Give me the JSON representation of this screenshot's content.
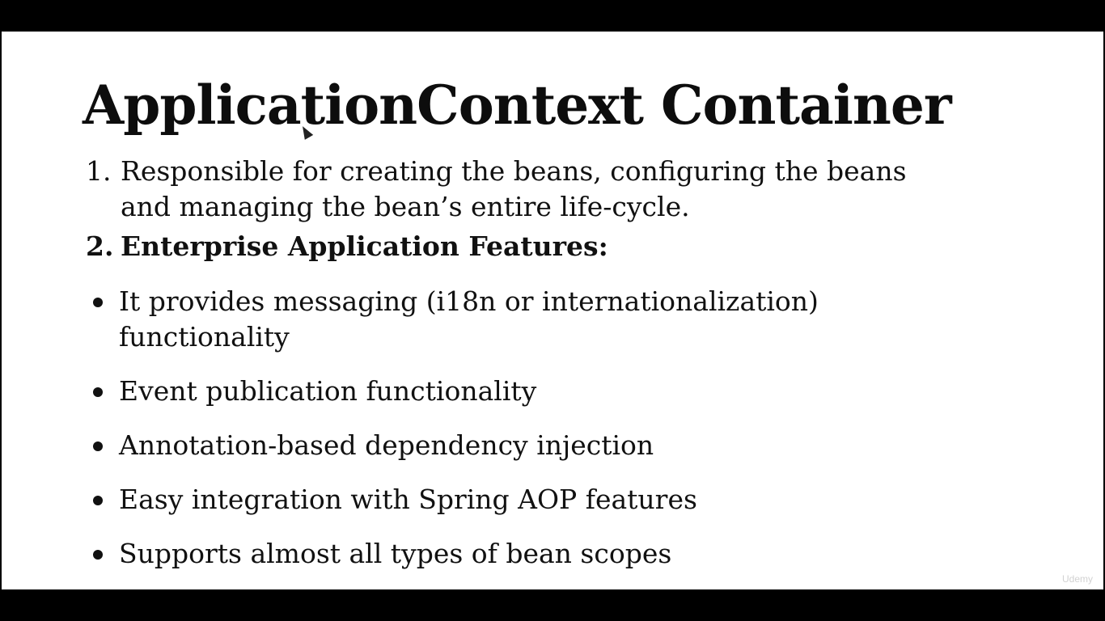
{
  "slide": {
    "title": "ApplicationContext Container",
    "point1": {
      "number": "1.",
      "line1": "Responsible for creating the beans, configuring the beans",
      "line2": "and managing the bean’s entire life-cycle."
    },
    "point2": {
      "number": "2.",
      "text": "Enterprise Application Features:"
    },
    "bullets": [
      {
        "line1": "It provides messaging (i18n or internationalization)",
        "line2": "functionality"
      },
      {
        "line1": "Event publication functionality"
      },
      {
        "line1": "Annotation-based dependency injection"
      },
      {
        "line1": "Easy integration with Spring AOP features"
      },
      {
        "line1": "Supports almost all types of bean scopes"
      }
    ],
    "watermark": "Udemy"
  }
}
